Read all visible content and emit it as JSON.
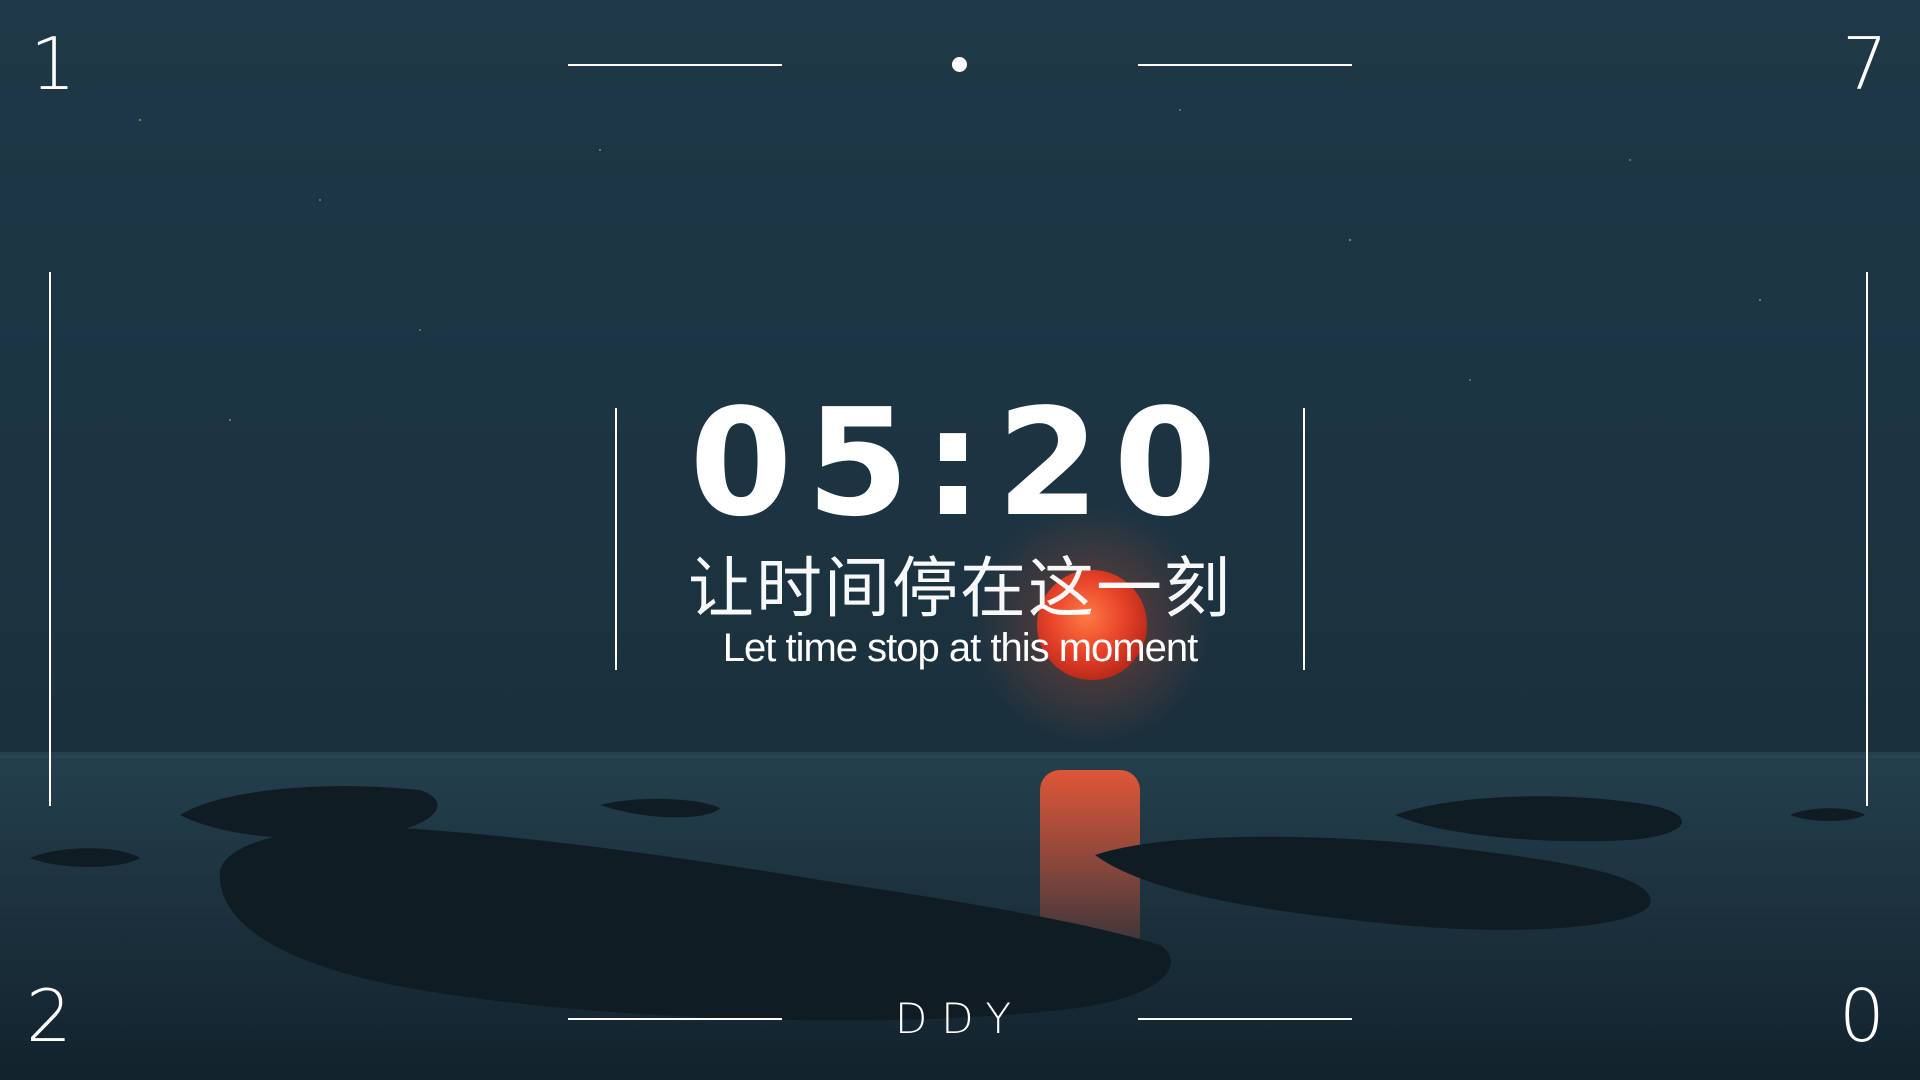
{
  "wallpaper": {
    "name": "night-sea-moon-wallpaper",
    "colors": {
      "sky_top": "#1e3847",
      "sky_bottom": "#1c3442",
      "sea": "#152733",
      "rock": "#0f1c24",
      "moon": "#e8442a",
      "moon_glow": "#ff6a3d",
      "text": "#ffffff"
    }
  },
  "date_corners": {
    "top_left": "1",
    "top_right": "7",
    "bottom_left": "2",
    "bottom_right": "0"
  },
  "clock": {
    "time": "05:20"
  },
  "tagline": {
    "chinese": "让时间停在这一刻",
    "english": "Let time stop at this moment"
  },
  "signature": "DDY"
}
